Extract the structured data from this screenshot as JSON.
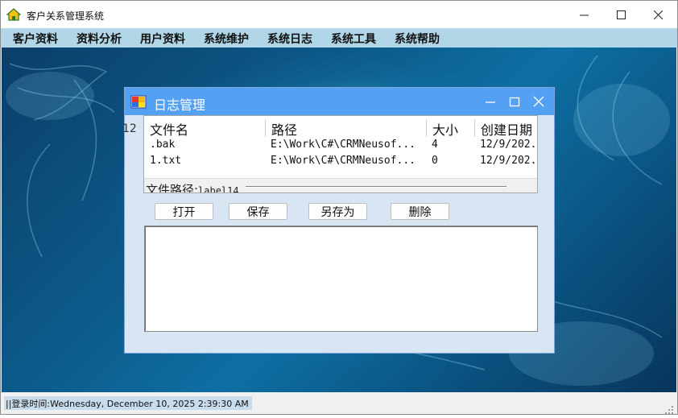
{
  "app": {
    "title": "客户关系管理系统"
  },
  "menu": [
    {
      "label": "客户资料"
    },
    {
      "label": "资料分析"
    },
    {
      "label": "用户资料"
    },
    {
      "label": "系统维护"
    },
    {
      "label": "系统日志"
    },
    {
      "label": "系统工具"
    },
    {
      "label": "系统帮助"
    }
  ],
  "log_window": {
    "title": "日志管理",
    "stray_label": "12",
    "columns": [
      "文件名",
      "路径",
      "大小",
      "创建日期"
    ],
    "rows": [
      {
        "name": ".bak",
        "path": "E:\\Work\\C#\\CRMNeusof...",
        "size": "4",
        "date": "12/9/202."
      },
      {
        "name": "1.txt",
        "path": "E:\\Work\\C#\\CRMNeusof...",
        "size": "0",
        "date": "12/9/202."
      }
    ],
    "file_path_label": "文件路径:",
    "file_path_value": "label14",
    "buttons": {
      "open": "打开",
      "save": "保存",
      "save_as": "另存为",
      "delete": "删除"
    },
    "text_content": ""
  },
  "status": {
    "login_time": "||登录时间:Wednesday, December 10, 2025 2:39:30 AM"
  },
  "icons": {
    "app": "house-icon",
    "log_window": "window-app-icon",
    "minimize": "minimize-icon",
    "maximize": "maximize-icon",
    "close": "close-icon",
    "grip": "resize-grip-icon"
  },
  "colors": {
    "menu_bar": "#b0d6e8",
    "child_titlebar": "#54a0f3",
    "child_body": "#d8e6f3",
    "desktop": "#0c5a8a",
    "status_label": "#c8dcec"
  }
}
